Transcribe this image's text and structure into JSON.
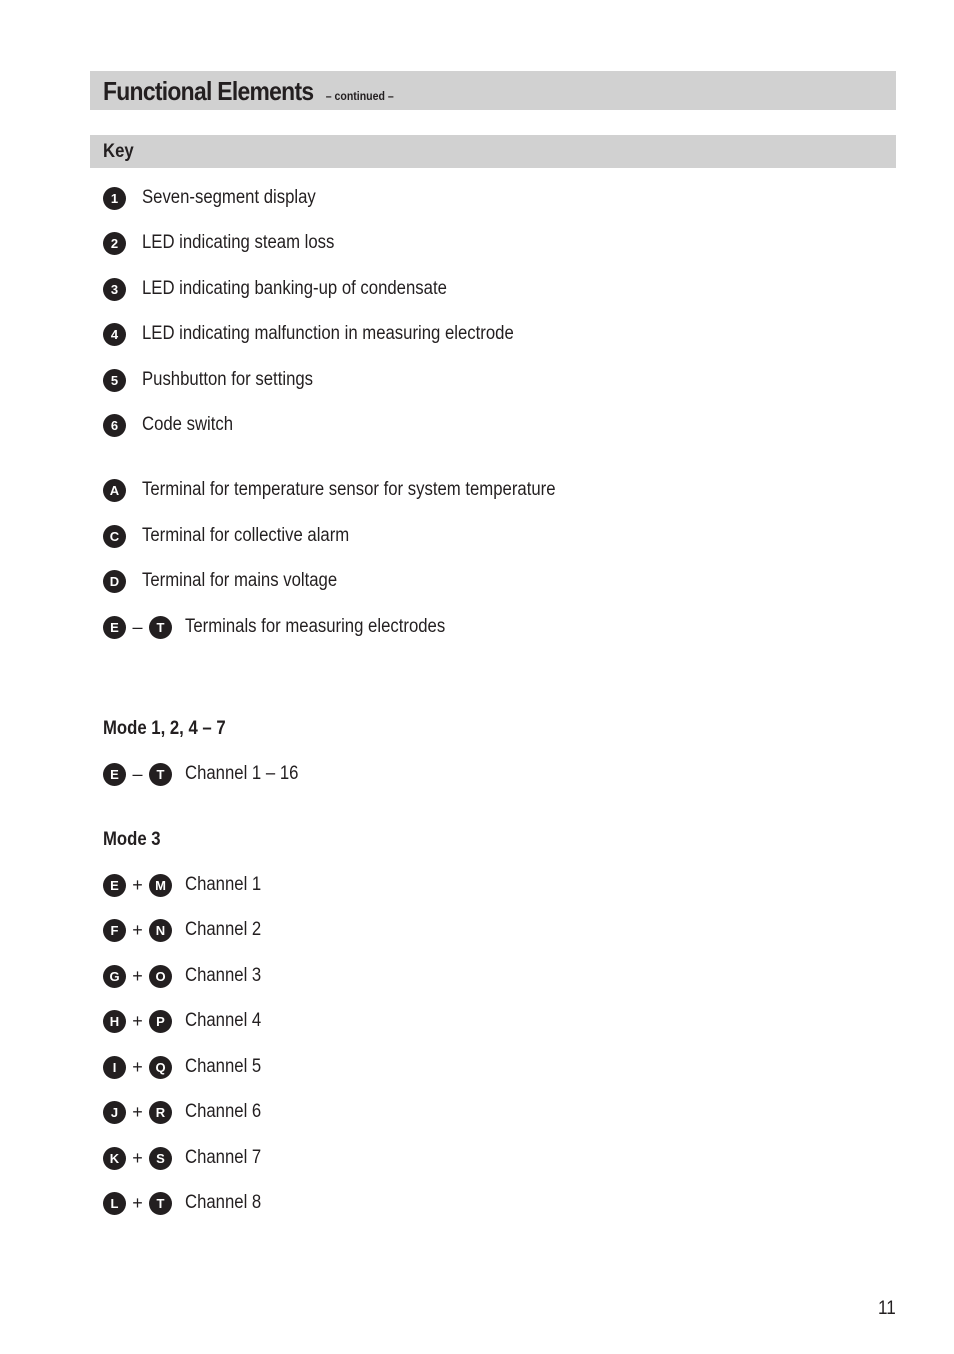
{
  "header": {
    "title": "Functional Elements",
    "continued": "– continued –"
  },
  "key_heading": "Key",
  "key_items": [
    {
      "marker": "1",
      "text": "Seven-segment display"
    },
    {
      "marker": "2",
      "text": "LED indicating steam loss"
    },
    {
      "marker": "3",
      "text": "LED indicating banking-up of condensate"
    },
    {
      "marker": "4",
      "text": "LED indicating malfunction in measuring electrode"
    },
    {
      "marker": "5",
      "text": "Pushbutton for settings"
    },
    {
      "marker": "6",
      "text": "Code switch"
    }
  ],
  "terminal_items": [
    {
      "marker": "A",
      "text": "Terminal for temperature sensor for system temperature"
    },
    {
      "marker": "C",
      "text": "Terminal for collective alarm"
    },
    {
      "marker": "D",
      "text": "Terminal for mains voltage"
    }
  ],
  "terminal_range": {
    "from": "E",
    "sep": "–",
    "to": "T",
    "text": "Terminals for measuring electrodes"
  },
  "mode_a": {
    "heading": "Mode 1, 2, 4 – 7",
    "item": {
      "from": "E",
      "sep": "–",
      "to": "T",
      "text": "Channel 1 – 16"
    }
  },
  "mode_b": {
    "heading": "Mode 3",
    "items": [
      {
        "a": "E",
        "b": "M",
        "text": "Channel 1"
      },
      {
        "a": "F",
        "b": "N",
        "text": "Channel 2"
      },
      {
        "a": "G",
        "b": "O",
        "text": "Channel 3"
      },
      {
        "a": "H",
        "b": "P",
        "text": "Channel 4"
      },
      {
        "a": "I",
        "b": "Q",
        "text": "Channel 5"
      },
      {
        "a": "J",
        "b": "R",
        "text": "Channel 6"
      },
      {
        "a": "K",
        "b": "S",
        "text": "Channel 7"
      },
      {
        "a": "L",
        "b": "T",
        "text": "Channel 8"
      }
    ],
    "sep": "+"
  },
  "page_number": "11"
}
